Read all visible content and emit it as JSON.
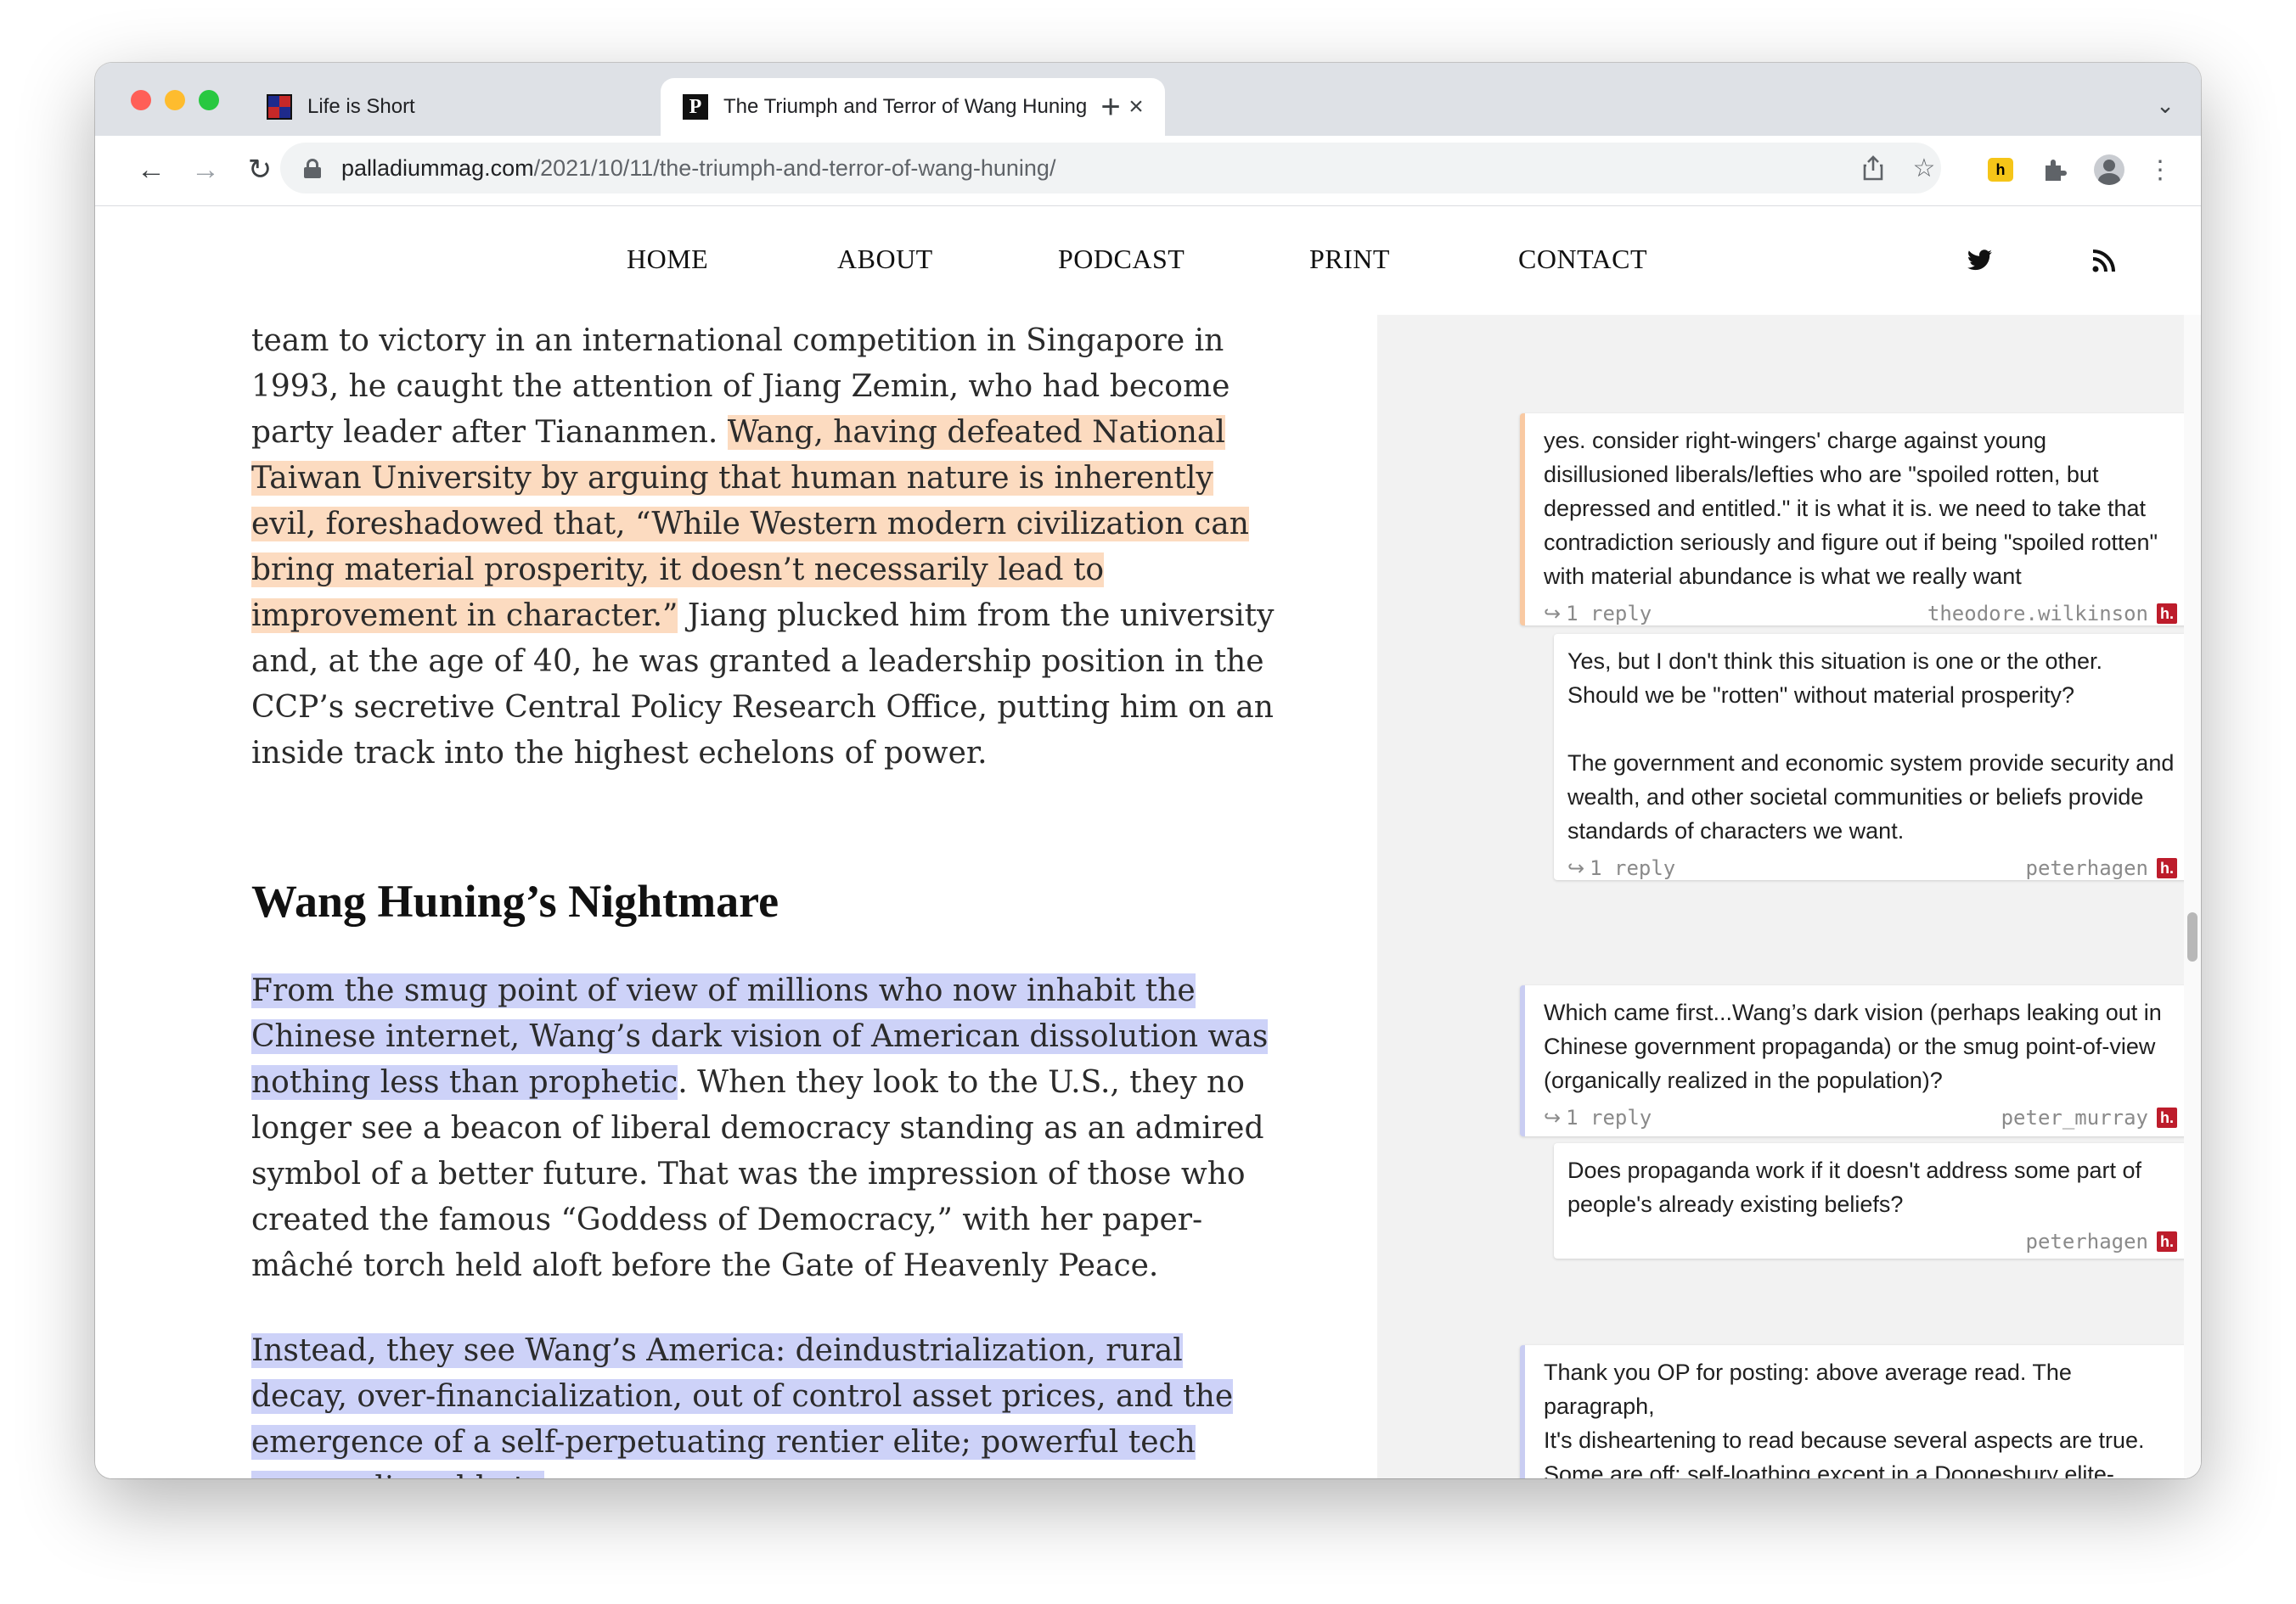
{
  "browser": {
    "tabs": [
      {
        "title": "Life is Short"
      },
      {
        "title": "The Triumph and Terror of Wang Huning"
      }
    ],
    "close_glyph": "×",
    "new_tab_glyph": "+",
    "tab_list_glyph": "⌄",
    "nav": {
      "back": "←",
      "forward": "→",
      "reload": "↻"
    },
    "url": {
      "host": "palladiummag.com",
      "path": "/2021/10/11/the-triumph-and-terror-of-wang-huning/"
    },
    "icons": {
      "share": "share-icon",
      "bookmark": "☆",
      "extension_h": "h",
      "extensions": "puzzle-icon",
      "menu": "⋮"
    }
  },
  "site_nav": {
    "links": [
      "HOME",
      "ABOUT",
      "PODCAST",
      "PRINT",
      "CONTACT"
    ]
  },
  "article": {
    "p1": {
      "before": "team to victory in an international competition in Singapore in 1993, he caught the attention of Jiang Zemin, who had become party leader after Tiananmen. ",
      "highlight": "Wang, having defeated National Taiwan University by arguing that human nature is inherently evil, foreshadowed that, “While Western modern civilization can bring material prosperity, it doesn’t necessarily lead to improvement in character.”",
      "after": " Jiang plucked him from the university and, at the age of 40, he was granted a leadership position in the CCP’s secretive Central Policy Research Office, putting him on an inside track into the highest echelons of power."
    },
    "heading": "Wang Huning’s Nightmare",
    "p2": {
      "highlight": "From the smug point of view of millions who now inhabit the Chinese internet, Wang’s dark vision of American dissolution was nothing less than prophetic",
      "after": ". When they look to the U.S., they no longer see a beacon of liberal democracy standing as an admired symbol of a better future. That was the impression of those who created the famous “Goddess of Democracy,” with her paper-mâché torch held aloft before the Gate of Heavenly Peace."
    },
    "p3": {
      "highlight": "Instead, they see Wang’s America: deindustrialization, rural decay, over-financialization, out of control asset prices, and the emergence of a self-perpetuating rentier elite; powerful tech monopolies able to"
    }
  },
  "annotations": [
    {
      "text": "yes. consider right-wingers' charge against young disillusioned liberals/lefties who are \"spoiled rotten, but depressed and entitled.\" it is what it is. we need to take that contradiction seriously and figure out if being \"spoiled rotten\" with material abundance is what we really want",
      "replies": "1 reply",
      "user": "theodore.wilkinson"
    },
    {
      "text": "Yes, but I don't think this situation is one or the other. Should we be \"rotten\" without material prosperity?\n\nThe government and economic system provide security and wealth, and other societal communities or beliefs provide standards of characters we want.",
      "replies": "1 reply",
      "user": "peterhagen"
    },
    {
      "text": "Which came first...Wang’s dark vision (perhaps leaking out in Chinese government propaganda) or the smug point-of-view (organically realized in the population)?",
      "replies": "1 reply",
      "user": "peter_murray"
    },
    {
      "text": "Does propaganda work if it doesn't address some part of people's already existing beliefs?",
      "user": "peterhagen"
    },
    {
      "text": "Thank you OP for posting: above average read. The paragraph,\nIt's disheartening to read because several aspects are true.\nSome are off: self-loathing except in a Doonesbury elite-"
    }
  ],
  "hypothesis_badge": "h.",
  "colors": {
    "highlight_orange": "#fcdbc0",
    "highlight_blue": "#cdd2f8",
    "hypothesis_red": "#bd1c2b"
  }
}
